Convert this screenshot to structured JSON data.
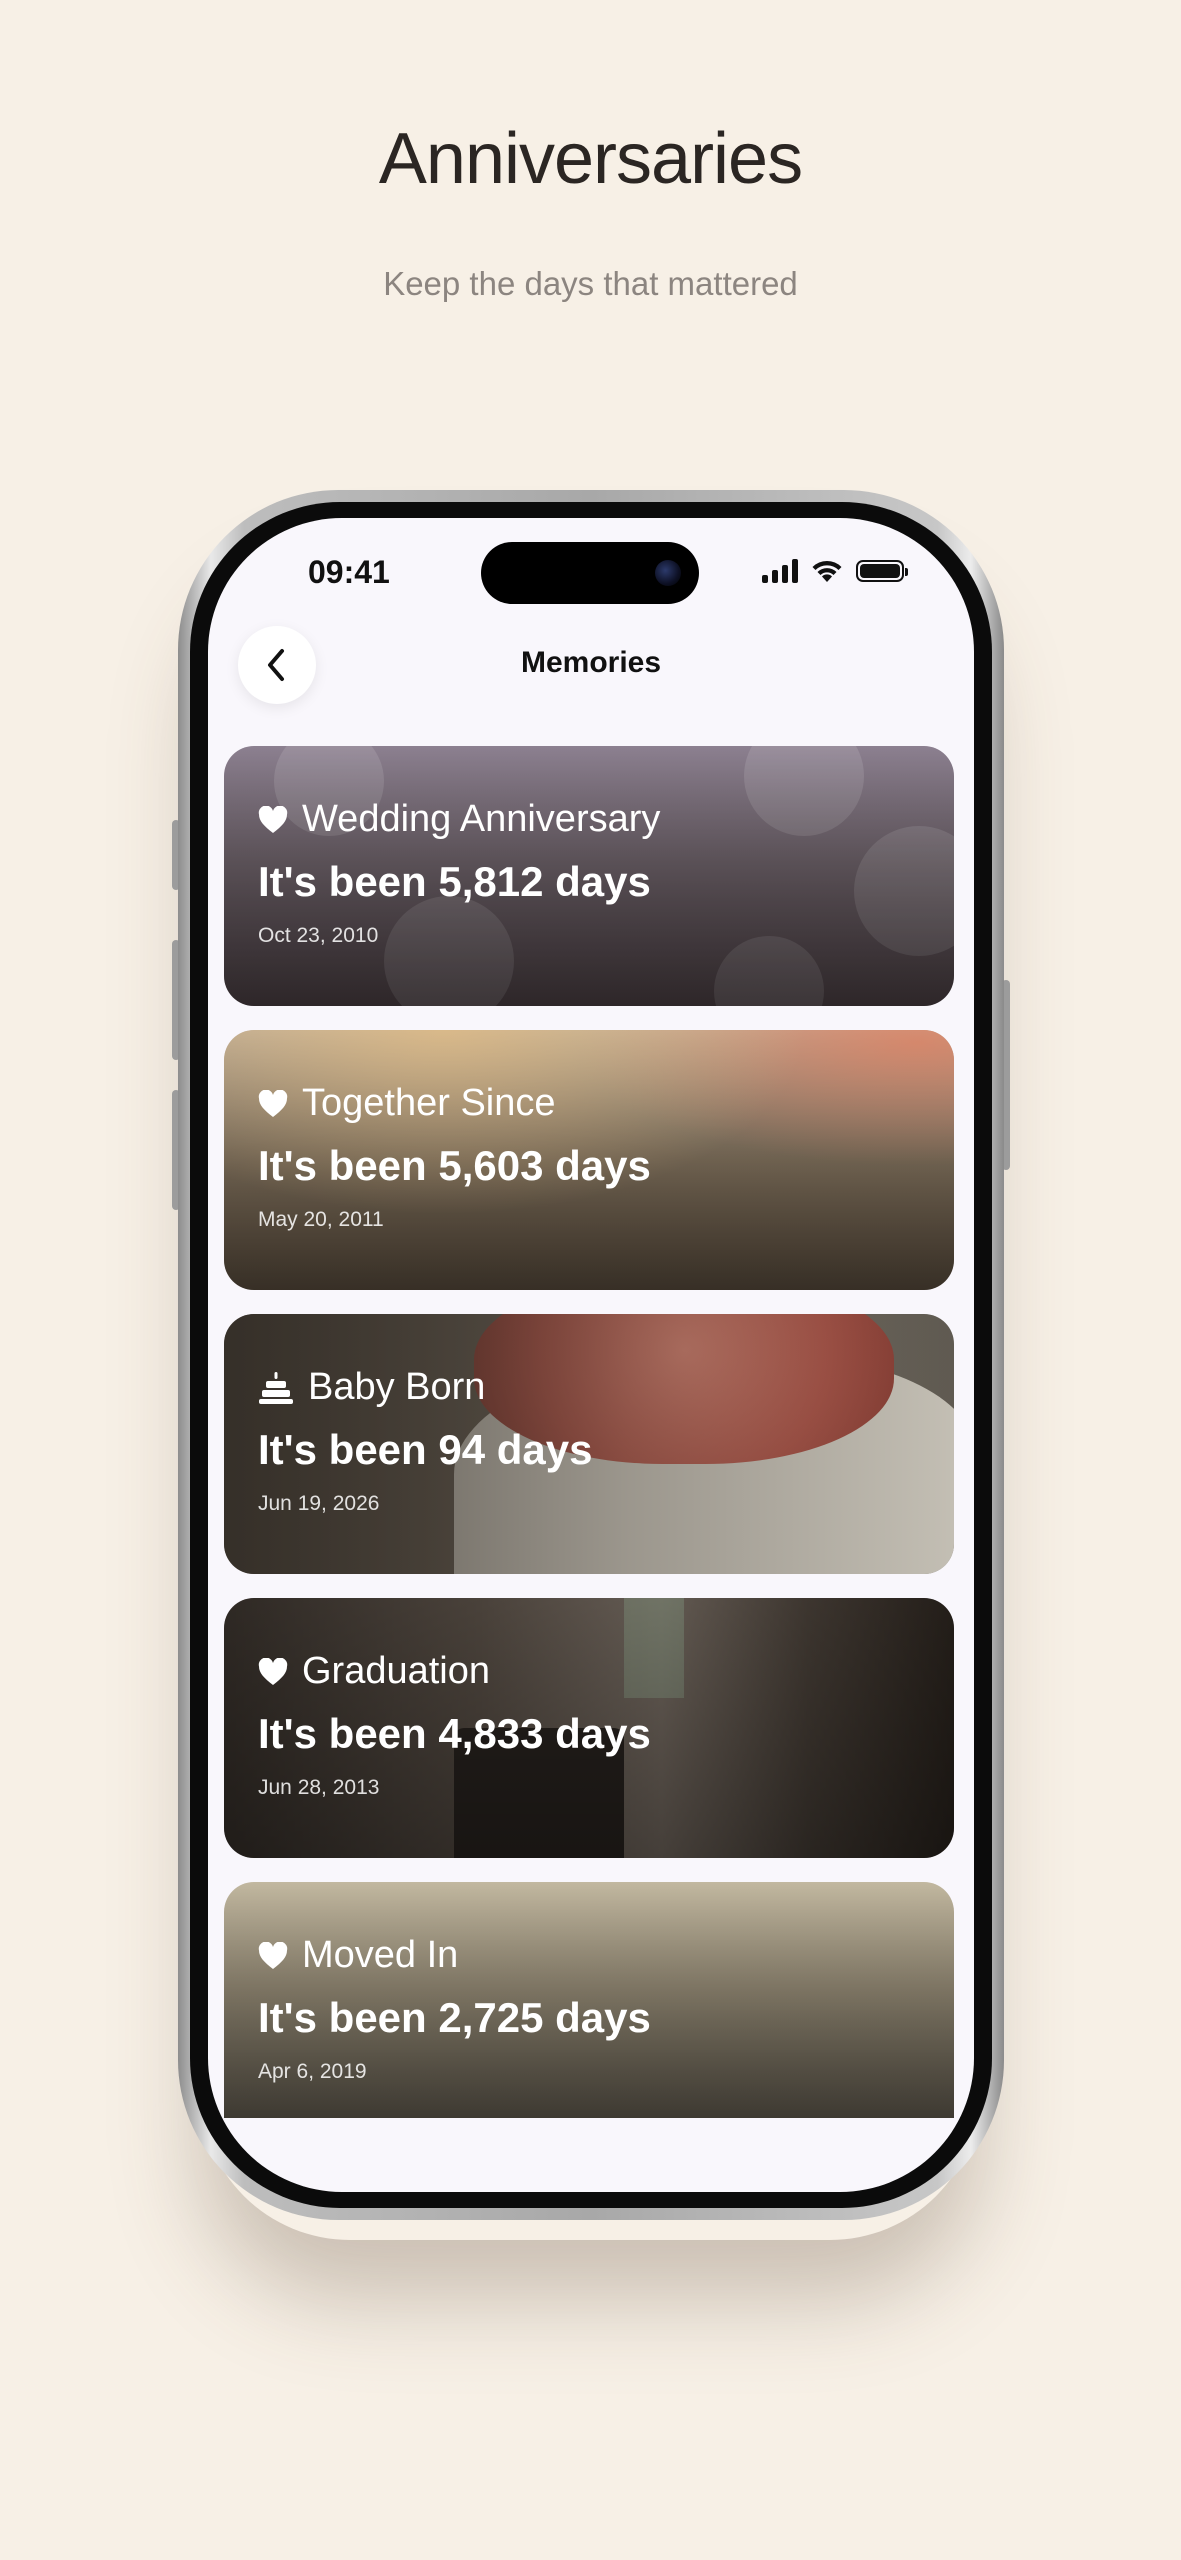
{
  "page": {
    "headline": "Anniversaries",
    "subline": "Keep the days that mattered"
  },
  "status_bar": {
    "time": "09:41"
  },
  "nav": {
    "title": "Memories"
  },
  "memories": [
    {
      "title": "Wedding Anniversary",
      "count": "It's been 5,812 days",
      "date": "Oct 23, 2010",
      "icon": "heart-icon"
    },
    {
      "title": "Together Since",
      "count": "It's been 5,603 days",
      "date": "May 20, 2011",
      "icon": "heart-icon"
    },
    {
      "title": "Baby Born",
      "count": "It's been 94 days",
      "date": "Jun 19, 2026",
      "icon": "cake-icon"
    },
    {
      "title": "Graduation",
      "count": "It's been 4,833 days",
      "date": "Jun 28, 2013",
      "icon": "heart-icon"
    },
    {
      "title": "Moved In",
      "count": "It's been 2,725 days",
      "date": "Apr 6, 2019",
      "icon": "heart-icon"
    }
  ],
  "colors": {
    "background": "#f7f0e6",
    "screen": "#f9f7fc"
  }
}
